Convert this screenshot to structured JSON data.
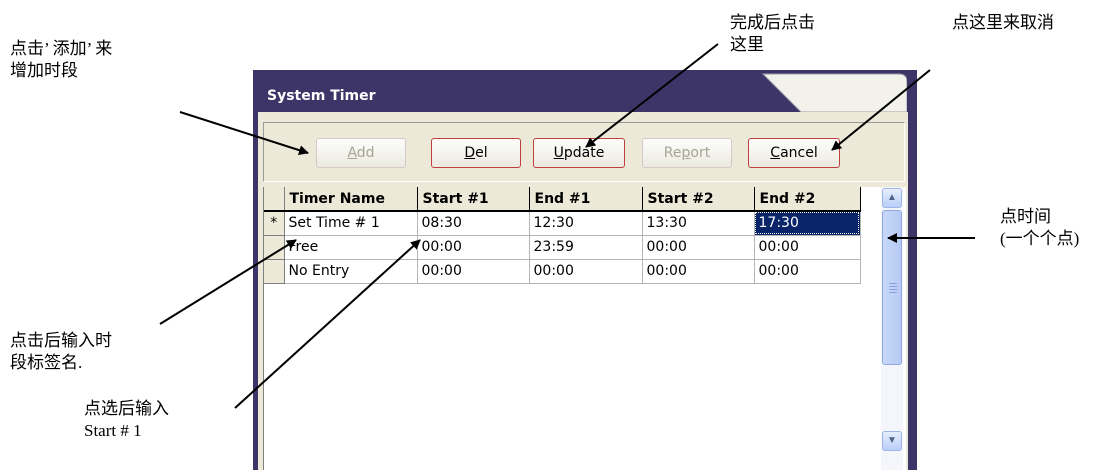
{
  "annotations": {
    "add_hint_line1": "点击’ 添加’ 来",
    "add_hint_line2": "增加时段",
    "update_hint_line1": "完成后点击",
    "update_hint_line2": "这里",
    "cancel_hint": "点这里来取消",
    "time_hint_line1": "点时间",
    "time_hint_line2": "(一个个点)",
    "name_hint_line1": "点击后输入时",
    "name_hint_line2": "段标签名.",
    "start_hint_line1": "点选后输入",
    "start_hint_line2": "Start # 1"
  },
  "window": {
    "title": "System Timer"
  },
  "toolbar": {
    "add": {
      "label": "Add",
      "enabled": false
    },
    "del": {
      "label": "Del",
      "enabled": true
    },
    "update": {
      "label": "Update",
      "enabled": true
    },
    "report": {
      "label": "Report",
      "enabled": false
    },
    "cancel": {
      "label": "Cancel",
      "enabled": true
    }
  },
  "table": {
    "columns": [
      "Timer Name",
      "Start #1",
      "End #1",
      "Start #2",
      "End #2"
    ],
    "rows": [
      {
        "marker": "*",
        "cells": [
          "Set Time # 1",
          "08:30",
          "12:30",
          "13:30",
          "17:30"
        ]
      },
      {
        "marker": "",
        "cells": [
          "Free",
          "00:00",
          "23:59",
          "00:00",
          "00:00"
        ]
      },
      {
        "marker": "",
        "cells": [
          "No Entry",
          "00:00",
          "00:00",
          "00:00",
          "00:00"
        ]
      }
    ]
  },
  "colors": {
    "window_frame": "#3d3468",
    "selected_cell": "#0a246a",
    "button_border": "#c04040"
  }
}
